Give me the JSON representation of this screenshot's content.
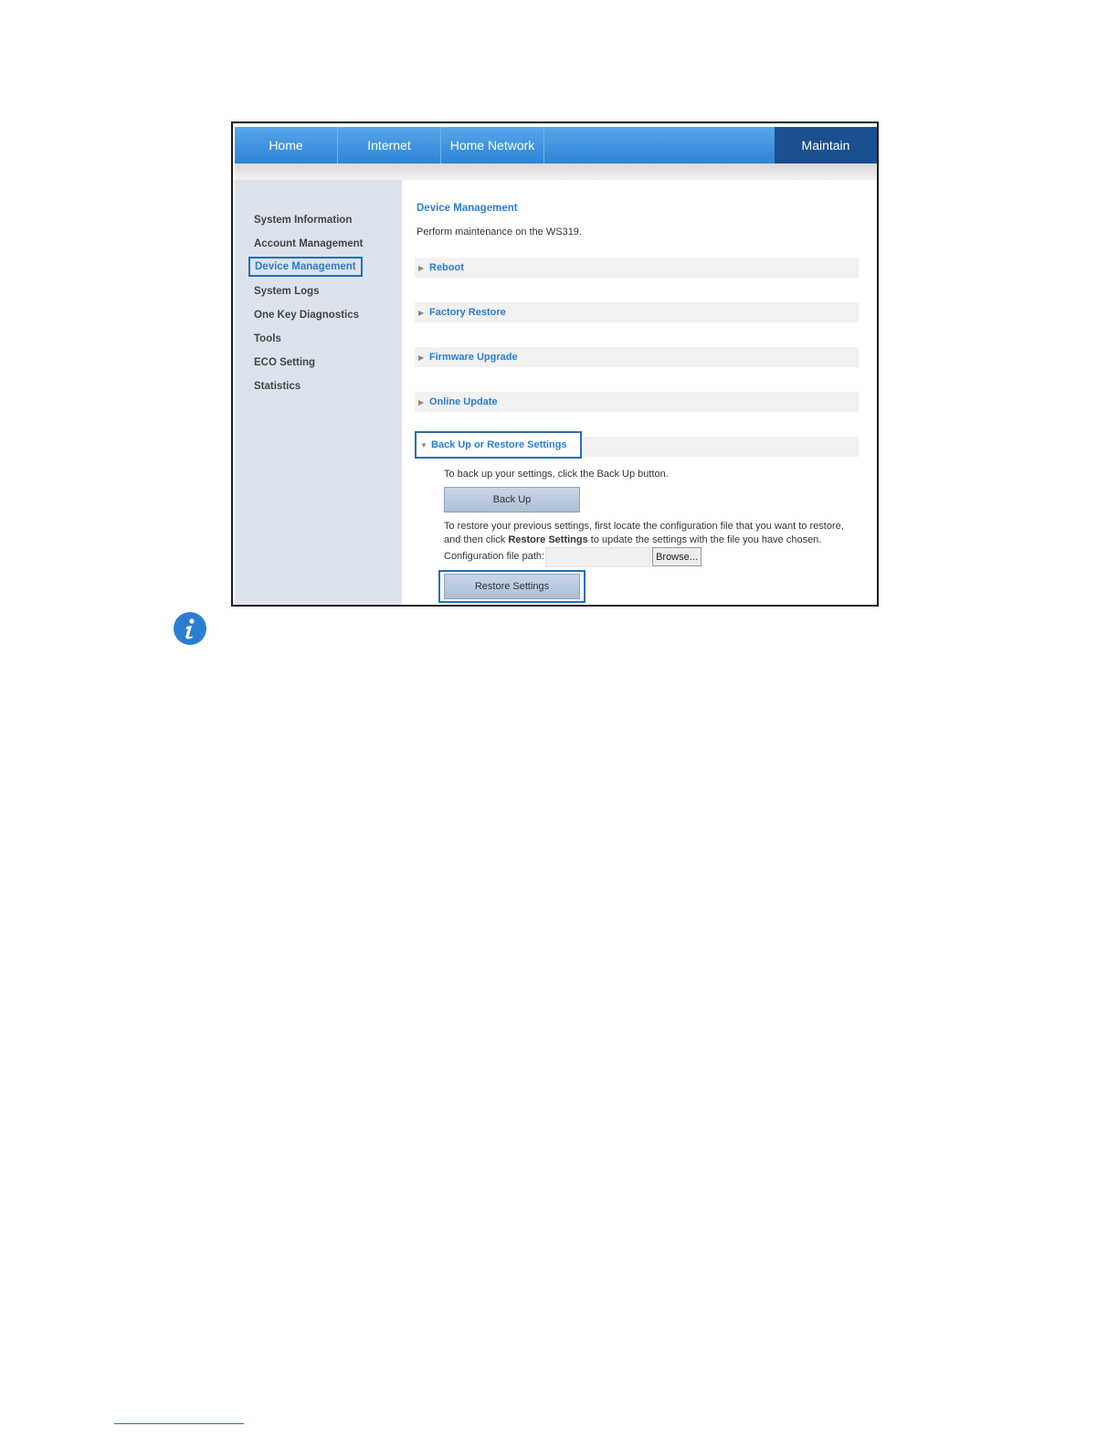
{
  "nav": {
    "tabs": [
      "Home",
      "Internet",
      "Home Network"
    ],
    "active_tab": "Maintain"
  },
  "sidebar": {
    "items": [
      "System Information",
      "Account Management",
      "Device Management",
      "System Logs",
      "One Key Diagnostics",
      "Tools",
      "ECO Setting",
      "Statistics"
    ],
    "active_index": 2
  },
  "main": {
    "title": "Device Management",
    "description": "Perform maintenance on the WS319.",
    "sections": [
      "Reboot",
      "Factory Restore",
      "Firmware Upgrade",
      "Online Update",
      "Back Up or Restore Settings"
    ],
    "backup": {
      "instruction": "To back up your settings, click the Back Up button.",
      "backup_button": "Back Up",
      "restore_instruction_1": "To restore your previous settings, first locate the configuration file that you want to restore,",
      "restore_instruction_2a": "and then click ",
      "restore_instruction_2b": "Restore Settings",
      "restore_instruction_2c": " to update the settings with the file you have chosen.",
      "config_label": "Configuration file path:",
      "config_value": "",
      "browse_button": "Browse...",
      "restore_button": "Restore Settings"
    }
  },
  "colors": {
    "nav_blue": "#2c84d6",
    "nav_active": "#1b4f8f",
    "link_blue": "#2a7ed2",
    "highlight_border": "#2a6db3",
    "info_icon": "#2a7ed2"
  },
  "icons": {
    "info": "info-icon",
    "collapsed": "triangle-right-icon",
    "expanded": "triangle-down-icon"
  }
}
